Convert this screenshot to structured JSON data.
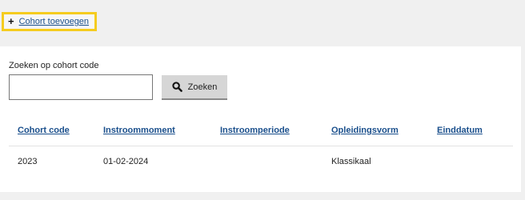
{
  "add_cohort": {
    "label": "Cohort toevoegen",
    "icon": "plus-icon"
  },
  "search": {
    "label": "Zoeken op cohort code",
    "value": "",
    "placeholder": "",
    "button_label": "Zoeken",
    "icon": "search-icon"
  },
  "table": {
    "columns": [
      "Cohort code",
      "Instroommoment",
      "Instroomperiode",
      "Opleidingsvorm",
      "Einddatum"
    ],
    "rows": [
      [
        "2023",
        "01-02-2024",
        "",
        "Klassikaal",
        ""
      ]
    ]
  },
  "colors": {
    "highlight": "#f5cc1f",
    "link": "#1a4f8c",
    "background": "#f0f0f0",
    "button": "#d6d6d6"
  }
}
